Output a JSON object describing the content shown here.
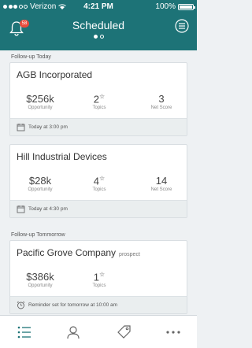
{
  "status": {
    "carrier": "Verizon",
    "time": "4:21 PM",
    "battery": "100%"
  },
  "header": {
    "title": "Scheduled",
    "notification_count": "58"
  },
  "sections": [
    {
      "label": "Follow-up Today",
      "cards": [
        {
          "name": "AGB Incorporated",
          "opportunity": "$256k",
          "opportunity_label": "Opportunity",
          "topics": "2",
          "topics_label": "Topics",
          "net_score": "3",
          "net_score_label": "Net Score",
          "footer": "Today at 3:00 pm"
        },
        {
          "name": "Hill Industrial Devices",
          "opportunity": "$28k",
          "opportunity_label": "Opportunity",
          "topics": "4",
          "topics_label": "Topics",
          "net_score": "14",
          "net_score_label": "Net Score",
          "footer": "Today at 4:30 pm"
        }
      ]
    },
    {
      "label": "Follow-up Tommorrow",
      "cards": [
        {
          "name": "Pacific Grove Company",
          "tag": "prospect",
          "opportunity": "$386k",
          "opportunity_label": "Opportunity",
          "topics": "1",
          "topics_label": "Topics",
          "footer": "Reminder set for tomorrow at 10:00 am"
        }
      ]
    }
  ],
  "colors": {
    "header": "#1d7377",
    "accent": "#1d7377",
    "badge": "#e84b3c"
  },
  "tabs": [
    "list-icon",
    "person-icon",
    "tag-icon",
    "more-icon"
  ]
}
